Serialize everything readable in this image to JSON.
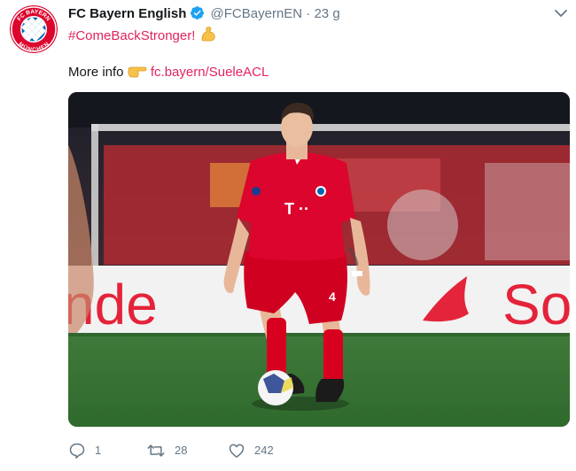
{
  "tweet": {
    "display_name": "FC Bayern English",
    "handle": "@FCBayernEN",
    "separator": "·",
    "time": "23 g",
    "hashtag": "#ComeBackStronger!",
    "more_info_label": "More info",
    "link_text": "fc.bayern/SueleACL",
    "logo_text": {
      "top": "FC BAYERN",
      "bottom": "MÜNCHEN"
    },
    "icons": {
      "verified": "verified-badge-icon",
      "flexed_biceps": "flexed-biceps-emoji",
      "pointing_right": "backhand-index-pointing-right-emoji",
      "caret": "chevron-down-icon",
      "reply": "reply-icon",
      "retweet": "retweet-icon",
      "like": "heart-icon"
    },
    "media": {
      "pitch_board_text": "nde",
      "pitch_board_text_right": "So",
      "shirt_sponsor": "T ··",
      "shirt_number": "4"
    }
  },
  "stats": {
    "replies": "1",
    "retweets": "28",
    "likes": "242"
  },
  "colors": {
    "accent": "#e0245e",
    "muted": "#657786",
    "verified_blue": "#1da1f2",
    "bayern_red": "#dc052d",
    "bayern_blue": "#0066b2"
  }
}
